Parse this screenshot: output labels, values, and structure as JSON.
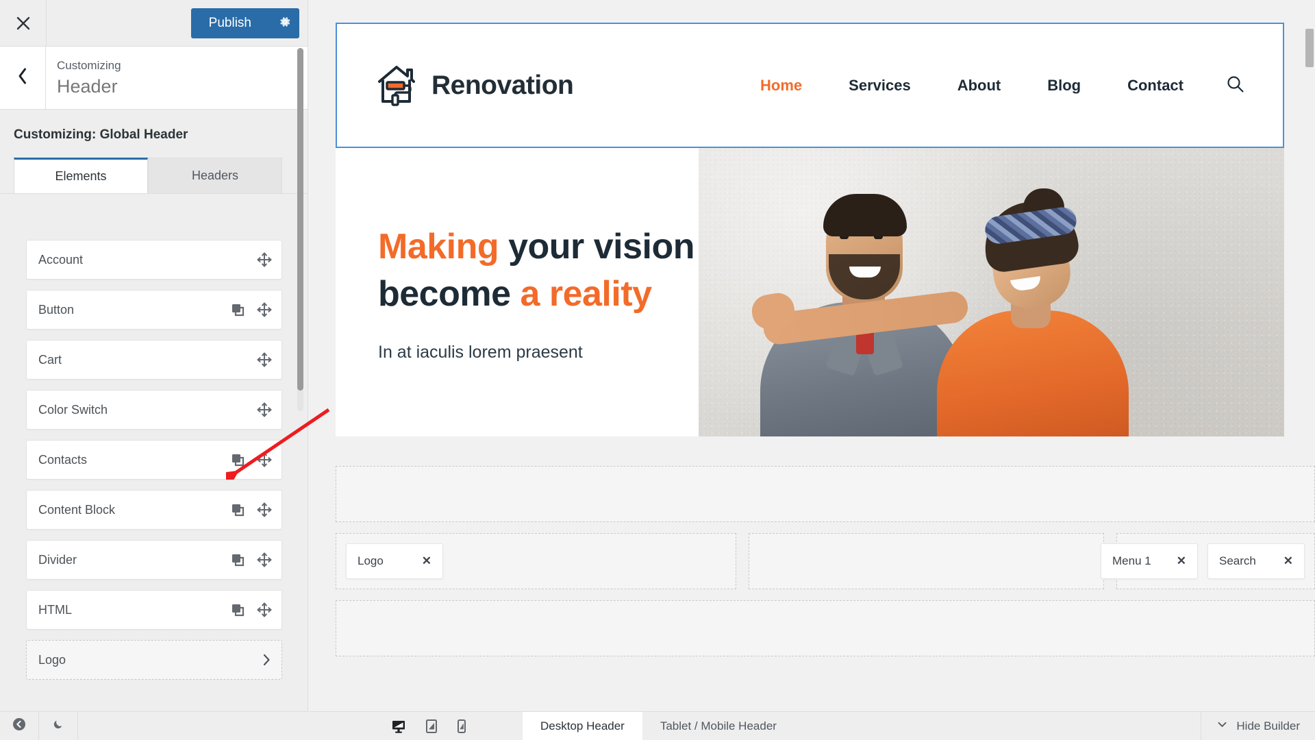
{
  "customizer": {
    "close_label": "Close",
    "publish_label": "Publish",
    "gear_label": "Publish settings",
    "breadcrumb_sub": "Customizing",
    "breadcrumb_title": "Header",
    "section_label": "Customizing: Global Header",
    "tabs": [
      {
        "label": "Elements",
        "active": true
      },
      {
        "label": "Headers",
        "active": false
      }
    ],
    "elements": [
      {
        "label": "Account",
        "has_duplicate": false,
        "has_move": true,
        "has_chevron": false,
        "dashed": false
      },
      {
        "label": "Button",
        "has_duplicate": true,
        "has_move": true,
        "has_chevron": false,
        "dashed": false
      },
      {
        "label": "Cart",
        "has_duplicate": false,
        "has_move": true,
        "has_chevron": false,
        "dashed": false
      },
      {
        "label": "Color Switch",
        "has_duplicate": false,
        "has_move": true,
        "has_chevron": false,
        "dashed": false
      },
      {
        "label": "Contacts",
        "has_duplicate": true,
        "has_move": true,
        "has_chevron": false,
        "dashed": false
      },
      {
        "label": "Content Block",
        "has_duplicate": true,
        "has_move": true,
        "has_chevron": false,
        "dashed": false
      },
      {
        "label": "Divider",
        "has_duplicate": true,
        "has_move": true,
        "has_chevron": false,
        "dashed": false
      },
      {
        "label": "HTML",
        "has_duplicate": true,
        "has_move": true,
        "has_chevron": false,
        "dashed": false
      },
      {
        "label": "Logo",
        "has_duplicate": false,
        "has_move": false,
        "has_chevron": true,
        "dashed": true
      }
    ],
    "bottom_bar": {
      "collapse_label": "Collapse",
      "dark_mode_label": "Dark mode"
    }
  },
  "preview": {
    "site": {
      "brand_name": "Renovation",
      "nav": [
        {
          "label": "Home",
          "active": true
        },
        {
          "label": "Services",
          "active": false
        },
        {
          "label": "About",
          "active": false
        },
        {
          "label": "Blog",
          "active": false
        },
        {
          "label": "Contact",
          "active": false
        }
      ],
      "search_label": "Search",
      "hero": {
        "line1_accent": "Making",
        "line1_rest": " your vision",
        "line2_rest": "become ",
        "line2_accent": "a reality",
        "subtitle": "In at iaculis lorem praesent"
      }
    },
    "builder": {
      "rows": [
        {
          "zones": [
            {
              "type": "full",
              "chips": []
            }
          ]
        },
        {
          "zones": [
            {
              "type": "left",
              "chips": [
                {
                  "label": "Logo"
                }
              ]
            },
            {
              "type": "center",
              "chips": []
            },
            {
              "type": "right",
              "chips": [
                {
                  "label": "Menu 1"
                },
                {
                  "label": "Search"
                }
              ]
            }
          ]
        },
        {
          "zones": [
            {
              "type": "full",
              "chips": []
            }
          ]
        }
      ]
    },
    "bottom_bar": {
      "device_desktop": "Desktop",
      "device_tablet": "Tablet",
      "device_mobile": "Mobile",
      "tabs": [
        {
          "label": "Desktop Header",
          "active": true
        },
        {
          "label": "Tablet / Mobile Header",
          "active": false
        }
      ],
      "hide_builder_label": "Hide Builder"
    }
  },
  "colors": {
    "accent_orange": "#f36b29",
    "publish_blue": "#2a6ca8",
    "tab_active_blue": "#2a6ca8",
    "preview_outline_blue": "#4a90d9",
    "dark_text": "#1d2b36",
    "annotation_red": "#ee1c20"
  }
}
